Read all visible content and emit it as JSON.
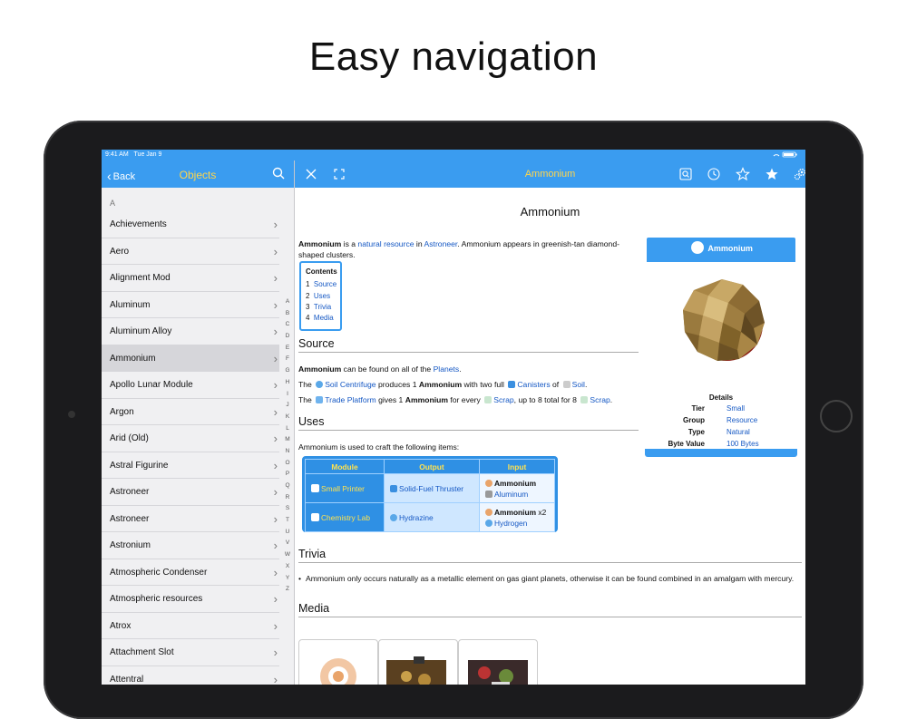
{
  "headline": "Easy navigation",
  "status_bar": {
    "time": "9:41 AM",
    "date": "Tue Jan 9"
  },
  "sidebar": {
    "back_label": "Back",
    "title": "Objects",
    "section_letter": "A",
    "items": [
      "Achievements",
      "Aero",
      "Alignment Mod",
      "Aluminum",
      "Aluminum Alloy",
      "Ammonium",
      "Apollo Lunar Module",
      "Argon",
      "Arid (Old)",
      "Astral Figurine",
      "Astroneer",
      "Astroneer",
      "Astronium",
      "Atmospheric Condenser",
      "Atmospheric resources",
      "Atrox",
      "Attachment Slot",
      "Attentral"
    ],
    "selected_item": "Ammonium",
    "alpha_index": [
      "A",
      "B",
      "C",
      "D",
      "E",
      "F",
      "G",
      "H",
      "I",
      "J",
      "K",
      "L",
      "M",
      "N",
      "O",
      "P",
      "Q",
      "R",
      "S",
      "T",
      "U",
      "V",
      "W",
      "X",
      "Y",
      "Z"
    ]
  },
  "main": {
    "nav_title": "Ammonium",
    "icons": [
      "close-icon",
      "expand-icon",
      "search-page-icon",
      "history-icon",
      "favorite-outline-icon",
      "favorites-icon",
      "settings-icon"
    ]
  },
  "article": {
    "title": "Ammonium",
    "intro": {
      "bold": "Ammonium",
      "t1": " is a ",
      "link1": "natural resource",
      "t2": " in ",
      "link2": "Astroneer",
      "t3": ". Ammonium appears in greenish-tan diamond-shaped clusters."
    },
    "toc": {
      "title": "Contents",
      "items": [
        {
          "num": "1",
          "label": "Source"
        },
        {
          "num": "2",
          "label": "Uses"
        },
        {
          "num": "3",
          "label": "Trivia"
        },
        {
          "num": "4",
          "label": "Media"
        }
      ]
    },
    "source": {
      "heading": "Source",
      "p1": {
        "bold": "Ammonium",
        "t1": " can be found on all of the ",
        "link": "Planets",
        "t2": "."
      },
      "p2": {
        "t1": "The ",
        "link1": "Soil Centrifuge",
        "t2": " produces 1 ",
        "bold": "Ammonium",
        "t3": " with two full ",
        "link2": "Canisters",
        "t4": " of ",
        "link3": "Soil",
        "t5": "."
      },
      "p3": {
        "t1": "The ",
        "link1": "Trade Platform",
        "t2": " gives 1 ",
        "bold": "Ammonium",
        "t3": " for every ",
        "link2": "Scrap",
        "t4": ", up to 8 total for 8 ",
        "link3": "Scrap",
        "t5": "."
      }
    },
    "uses": {
      "heading": "Uses",
      "intro": "Ammonium is used to craft the following items:",
      "table": {
        "headers": [
          "Module",
          "Output",
          "Input"
        ],
        "rows": [
          {
            "module": "Small Printer",
            "output": "Solid-Fuel Thruster",
            "input_bold": "Ammonium",
            "input_qty": "",
            "input_link": "Aluminum"
          },
          {
            "module": "Chemistry Lab",
            "output": "Hydrazine",
            "input_bold": "Ammonium",
            "input_qty": " x2",
            "input_link": "Hydrogen"
          }
        ]
      }
    },
    "trivia": {
      "heading": "Trivia",
      "text": "Ammonium only occurs naturally as a metallic element on gas giant planets, otherwise it can be found combined in an amalgam with mercury."
    },
    "media": {
      "heading": "Media"
    },
    "infobox": {
      "title": "Ammonium",
      "details_label": "Details",
      "rows": [
        {
          "key": "Tier",
          "value": "Small"
        },
        {
          "key": "Group",
          "value": "Resource"
        },
        {
          "key": "Type",
          "value": "Natural"
        },
        {
          "key": "Byte Value",
          "value": "100 Bytes"
        }
      ]
    }
  },
  "colors": {
    "nav_blue": "#3a9cf0",
    "title_yellow": "#ffd54a",
    "link_blue": "#1558c4"
  }
}
